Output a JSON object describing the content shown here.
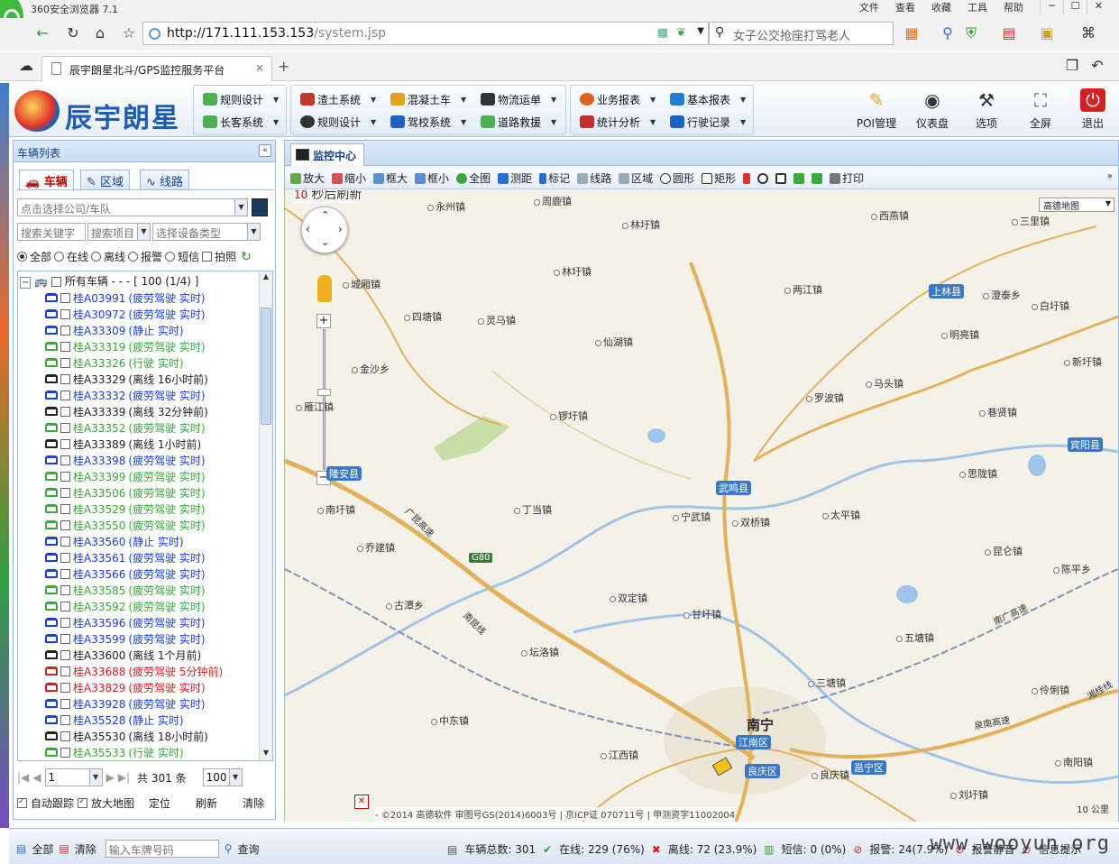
{
  "browser": {
    "title": "360安全浏览器 7.1",
    "menu": [
      "文件",
      "查看",
      "收藏",
      "工具",
      "帮助"
    ],
    "url_host": "http://171.111.153.153",
    "url_path": "/system.jsp",
    "search_text": "女子公交抢座打骂老人",
    "tab_title": "辰宇朗星北斗/GPS监控服务平台",
    "tab_close": "×",
    "new_tab": "+"
  },
  "app": {
    "brand": "辰宇朗星",
    "menu_groups": [
      {
        "items": [
          {
            "label": "规则设计",
            "color": "#4caf50"
          },
          {
            "label": "长客系统",
            "color": "#4caf50"
          }
        ]
      },
      {
        "items": [
          {
            "label": "渣土系统",
            "color": "#c0392b"
          },
          {
            "label": "混凝土车",
            "color": "#e0a020"
          },
          {
            "label": "物流运单",
            "color": "#333333"
          },
          {
            "label": "规则设计",
            "color": "#333333"
          },
          {
            "label": "驾校系统",
            "color": "#2060c0"
          },
          {
            "label": "道路救援",
            "color": "#4caf50"
          }
        ]
      },
      {
        "items": [
          {
            "label": "业务报表",
            "color": "#e06020"
          },
          {
            "label": "基本报表",
            "color": "#2080d0"
          },
          {
            "label": "统计分析",
            "color": "#c03030"
          },
          {
            "label": "行驶记录",
            "color": "#2060c0"
          }
        ]
      }
    ],
    "big_buttons": [
      {
        "label": "POI管理",
        "icon": "pin-icon"
      },
      {
        "label": "仪表盘",
        "icon": "gauge-icon"
      },
      {
        "label": "选项",
        "icon": "tools-icon"
      },
      {
        "label": "全屏",
        "icon": "fullscreen-icon"
      },
      {
        "label": "退出",
        "icon": "power-icon"
      }
    ]
  },
  "left": {
    "title": "车辆列表",
    "tabs": [
      "车辆",
      "区域",
      "线路"
    ],
    "company_placeholder": "点击选择公司/车队",
    "keyword_placeholder": "搜索关键字",
    "search_item": "搜索项目",
    "device_type": "选择设备类型",
    "filters": [
      "全部",
      "在线",
      "离线",
      "报警",
      "短信"
    ],
    "photo": "拍照",
    "tree_root": "所有车辆 - - - [ 100 (1/4) ]",
    "vehicles": [
      {
        "plate": "桂A03991",
        "status": "(疲劳驾驶 实时)",
        "color": "#1a3fd6"
      },
      {
        "plate": "桂A30972",
        "status": "(疲劳驾驶 实时)",
        "color": "#1a3fd6"
      },
      {
        "plate": "桂A33309",
        "status": "(静止 实时)",
        "color": "#1a3fd6"
      },
      {
        "plate": "桂A33319",
        "status": "(疲劳驾驶 实时)",
        "color": "#3aa83a"
      },
      {
        "plate": "桂A33326",
        "status": "(行驶 实时)",
        "color": "#3aa83a"
      },
      {
        "plate": "桂A33329",
        "status": "(离线 16小时前)",
        "color": "#222222"
      },
      {
        "plate": "桂A33332",
        "status": "(疲劳驾驶 实时)",
        "color": "#1a3fd6"
      },
      {
        "plate": "桂A33339",
        "status": "(离线 32分钟前)",
        "color": "#222222"
      },
      {
        "plate": "桂A33352",
        "status": "(疲劳驾驶 实时)",
        "color": "#3aa83a"
      },
      {
        "plate": "桂A33389",
        "status": "(离线 1小时前)",
        "color": "#222222"
      },
      {
        "plate": "桂A33398",
        "status": "(疲劳驾驶 实时)",
        "color": "#1a3fd6"
      },
      {
        "plate": "桂A33399",
        "status": "(疲劳驾驶 实时)",
        "color": "#3aa83a"
      },
      {
        "plate": "桂A33506",
        "status": "(疲劳驾驶 实时)",
        "color": "#3aa83a"
      },
      {
        "plate": "桂A33529",
        "status": "(疲劳驾驶 实时)",
        "color": "#3aa83a"
      },
      {
        "plate": "桂A33550",
        "status": "(疲劳驾驶 实时)",
        "color": "#3aa83a"
      },
      {
        "plate": "桂A33560",
        "status": "(静止 实时)",
        "color": "#1a3fd6"
      },
      {
        "plate": "桂A33561",
        "status": "(疲劳驾驶 实时)",
        "color": "#1a3fd6"
      },
      {
        "plate": "桂A33566",
        "status": "(疲劳驾驶 实时)",
        "color": "#1a3fd6"
      },
      {
        "plate": "桂A33585",
        "status": "(疲劳驾驶 实时)",
        "color": "#3aa83a"
      },
      {
        "plate": "桂A33592",
        "status": "(疲劳驾驶 实时)",
        "color": "#3aa83a"
      },
      {
        "plate": "桂A33596",
        "status": "(疲劳驾驶 实时)",
        "color": "#1a3fd6"
      },
      {
        "plate": "桂A33599",
        "status": "(疲劳驾驶 实时)",
        "color": "#1a3fd6"
      },
      {
        "plate": "桂A33600",
        "status": "(离线 1个月前)",
        "color": "#222222"
      },
      {
        "plate": "桂A33688",
        "status": "(疲劳驾驶 5分钟前)",
        "color": "#d42020"
      },
      {
        "plate": "桂A33829",
        "status": "(疲劳驾驶 实时)",
        "color": "#d42020"
      },
      {
        "plate": "桂A33928",
        "status": "(疲劳驾驶 实时)",
        "color": "#1a3fd6"
      },
      {
        "plate": "桂A35528",
        "status": "(静止 实时)",
        "color": "#1a3fd6"
      },
      {
        "plate": "桂A35530",
        "status": "(离线 18小时前)",
        "color": "#222222"
      },
      {
        "plate": "桂A35533",
        "status": "(行驶 实时)",
        "color": "#3aa83a"
      }
    ],
    "page": "1",
    "total": "共 301 条",
    "page_size": "100",
    "auto_track": "自动跟踪",
    "zoom_map": "放大地图",
    "locate": "定位",
    "refresh": "刷新",
    "clear": "清除"
  },
  "map": {
    "tab": "监控中心",
    "tools": [
      "放大",
      "缩小",
      "框大",
      "框小",
      "全图",
      "测距",
      "标记",
      "线路",
      "区域",
      "圆形",
      "矩形",
      "打印"
    ],
    "refresh_seconds": "10",
    "refresh_text": "秒后刷新",
    "map_type": "高德地图",
    "copyright": "- ©2014 高德软件 审图号GS(2014)6003号 | 京ICP证 070711号 | 甲测资字11002004",
    "scale": "10 公里",
    "city": "南宁",
    "counties": [
      "上林县",
      "宾阳县",
      "武鸣县",
      "隆安县",
      "江南区",
      "良庆区",
      "邕宁区"
    ],
    "towns": [
      "永州镇",
      "周鹿镇",
      "林圩镇",
      "西燕镇",
      "三里镇",
      "林圩镇",
      "城厢镇",
      "两江镇",
      "澄泰乡",
      "白圩镇",
      "四塘镇",
      "灵马镇",
      "仙湖镇",
      "明亮镇",
      "新圩镇",
      "金沙乡",
      "罗波镇",
      "马头镇",
      "雁江镇",
      "锣圩镇",
      "巷贤镇",
      "思陇镇",
      "南圩镇",
      "丁当镇",
      "宁武镇",
      "双桥镇",
      "太平镇",
      "乔建镇",
      "昆仑镇",
      "陈平乡",
      "双定镇",
      "古潭乡",
      "甘圩镇",
      "五塘镇",
      "坛洛镇",
      "三塘镇",
      "伶俐镇",
      "中东镇",
      "江西镇",
      "良庆镇",
      "南阳镇",
      "刘圩镇"
    ],
    "roads": [
      "广昆高速",
      "G80",
      "南昆线",
      "南广高速",
      "泉南高速",
      "湘桂线"
    ]
  },
  "status": {
    "select_all": "全部",
    "clear": "清除",
    "plate_placeholder": "输入车牌号码",
    "query": "查询",
    "total": "车辆总数: 301",
    "online": "在线: 229 (76%)",
    "offline": "离线: 72 (23.9%)",
    "sms": "短信: 0 (0%)",
    "alarm": "报警: 24(7.9%)",
    "alarm_mute": "报警静音",
    "info_tip": "信息提示",
    "watermark": "www.wooyun.org"
  }
}
